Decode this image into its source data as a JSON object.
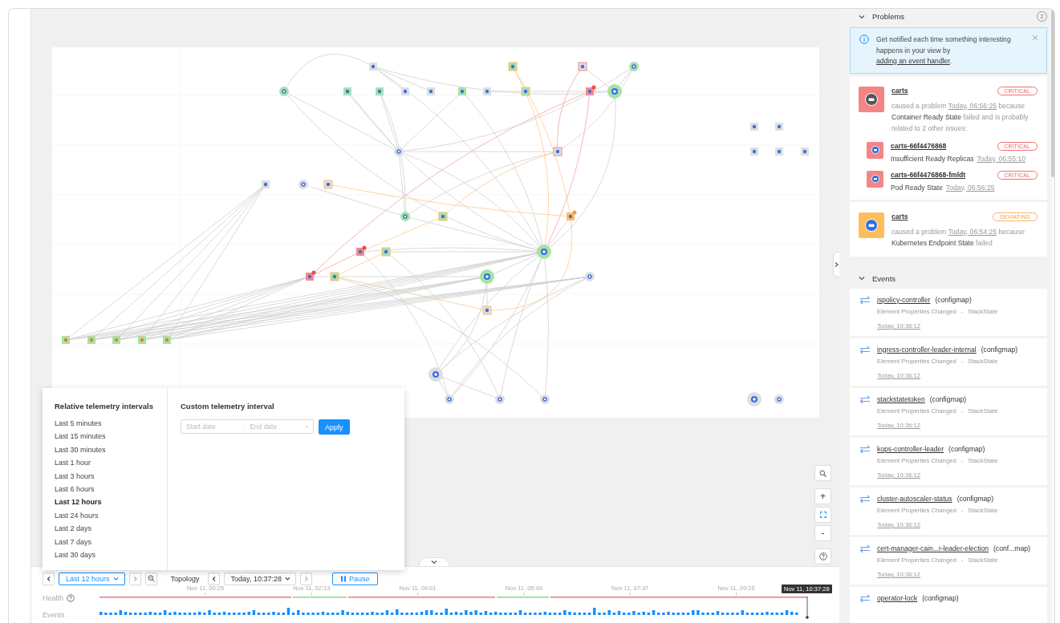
{
  "problems": {
    "title": "Problems",
    "count": "2",
    "expanded": true,
    "notice": {
      "text": "Get notified each time something interesting happens in your view by",
      "link": "adding an event handler",
      "end": "."
    },
    "items": [
      {
        "name": "carts",
        "kind": "critical",
        "badge": "CRITICAL",
        "lead": "caused a problem",
        "time": "Today, 06:56:25",
        "because": "because",
        "check": "Container Ready State",
        "tail": "failed and is probably related to 2 other issues:",
        "related": [
          {
            "name": "carts-66f4476868",
            "kind": "critical",
            "badge": "CRITICAL",
            "check": "Insufficient Ready Replicas",
            "time": "Today, 06:55:10"
          },
          {
            "name": "carts-66f4476868-fmldt",
            "kind": "critical",
            "badge": "CRITICAL",
            "check": "Pod Ready State",
            "time": "Today, 06:56:25"
          }
        ]
      },
      {
        "name": "carts",
        "kind": "deviating",
        "badge": "DEVIATING",
        "lead": "caused a problem",
        "time": "Today, 06:54:25",
        "because": "because",
        "check": "Kubernetes Endpoint State",
        "tail": "failed"
      }
    ]
  },
  "events": {
    "title": "Events",
    "expanded": true,
    "items": [
      {
        "name": "jspolicy-controller",
        "type": "(configmap)",
        "description": "Element Properties Changed",
        "separator": "-",
        "source": "StackState",
        "time": "Today, 10:36:12"
      },
      {
        "name": "ingress-controller-leader-internal",
        "type": "(configmap)",
        "description": "Element Properties Changed",
        "separator": "-",
        "source": "StackState",
        "time": "Today, 10:36:12"
      },
      {
        "name": "stackstatetoken",
        "type": "(configmap)",
        "description": "Element Properties Changed",
        "separator": "-",
        "source": "StackState",
        "time": "Today, 10:36:12"
      },
      {
        "name": "kops-controller-leader",
        "type": "(configmap)",
        "description": "Element Properties Changed",
        "separator": "-",
        "source": "StackState",
        "time": "Today, 10:36:12"
      },
      {
        "name": "cluster-autoscaler-status",
        "type": "(configmap)",
        "description": "Element Properties Changed",
        "separator": "-",
        "source": "StackState",
        "time": "Today, 10:36:12"
      },
      {
        "name": "cert-manager-cain...r-leader-election",
        "type": "(conf...map)",
        "description": "Element Properties Changed",
        "separator": "-",
        "source": "StackState",
        "time": "Today, 10:36:12"
      },
      {
        "name": "operator-lock",
        "type": "(configmap)"
      }
    ]
  },
  "telemetry_menu": {
    "relative_title": "Relative telemetry intervals",
    "options": [
      {
        "label": "Last 5 minutes",
        "selected": false
      },
      {
        "label": "Last 15 minutes",
        "selected": false
      },
      {
        "label": "Last 30 minutes",
        "selected": false
      },
      {
        "label": "Last 1 hour",
        "selected": false
      },
      {
        "label": "Last 3 hours",
        "selected": false
      },
      {
        "label": "Last 6 hours",
        "selected": false
      },
      {
        "label": "Last 12 hours",
        "selected": true
      },
      {
        "label": "Last 24 hours",
        "selected": false
      },
      {
        "label": "Last 2 days",
        "selected": false
      },
      {
        "label": "Last 7 days",
        "selected": false
      },
      {
        "label": "Last 30 days",
        "selected": false
      }
    ],
    "custom_title": "Custom telemetry interval",
    "start_placeholder": "Start date",
    "end_placeholder": "End date",
    "apply": "Apply"
  },
  "toolbar": {
    "interval": "Last 12 hours",
    "interval_open": true,
    "view": "Topology",
    "time": "Today, 10:37:28",
    "pause": "Pause"
  },
  "zoom_controls": {
    "zoom_in": "+",
    "zoom_out": "-"
  },
  "timeline": {
    "health_label": "Health",
    "events_label": "Events",
    "ticks": [
      "Nov 11, 00:25",
      "Nov 11, 02:13",
      "Nov 11, 04:01",
      "Nov 11, 05:49",
      "Nov 11, 07:37",
      "Nov 11, 09:25"
    ],
    "cursor": "Nov 11, 10:37:28"
  }
}
